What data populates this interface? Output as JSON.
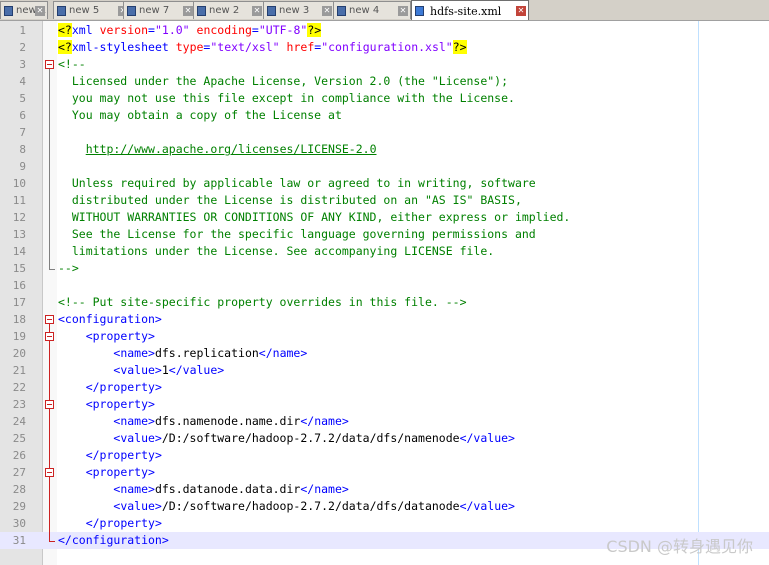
{
  "tabs": [
    {
      "label": "new 1",
      "active": false
    },
    {
      "label": "new 5",
      "active": false
    },
    {
      "label": "new 7",
      "active": false
    },
    {
      "label": "new 2",
      "active": false
    },
    {
      "label": "new 3",
      "active": false
    },
    {
      "label": "new 4",
      "active": false
    },
    {
      "label": "hdfs-site.xml",
      "active": true
    }
  ],
  "tab_icon": "document-icon",
  "close_icon": "close-icon",
  "current_line": 31,
  "lines": [
    {
      "n": "1",
      "tokens": [
        [
          "p",
          "<?"
        ],
        [
          "kw",
          "xml "
        ],
        [
          "at",
          "version"
        ],
        [
          "kw",
          "="
        ],
        [
          "str",
          "\"1.0\""
        ],
        [
          "kw",
          " "
        ],
        [
          "at",
          "encoding"
        ],
        [
          "kw",
          "="
        ],
        [
          "str",
          "\"UTF-8\""
        ],
        [
          "p",
          "?>"
        ]
      ]
    },
    {
      "n": "2",
      "tokens": [
        [
          "p",
          "<?"
        ],
        [
          "kw",
          "xml-stylesheet "
        ],
        [
          "at",
          "type"
        ],
        [
          "kw",
          "="
        ],
        [
          "str",
          "\"text/xsl\""
        ],
        [
          "kw",
          " "
        ],
        [
          "at",
          "href"
        ],
        [
          "kw",
          "="
        ],
        [
          "str",
          "\"configuration.xsl\""
        ],
        [
          "p",
          "?>"
        ]
      ]
    },
    {
      "n": "3",
      "tokens": [
        [
          "cm",
          "<!--"
        ]
      ]
    },
    {
      "n": "4",
      "tokens": [
        [
          "cm",
          "  Licensed under the Apache License, Version 2.0 (the \"License\");"
        ]
      ]
    },
    {
      "n": "5",
      "tokens": [
        [
          "cm",
          "  you may not use this file except in compliance with the License."
        ]
      ]
    },
    {
      "n": "6",
      "tokens": [
        [
          "cm",
          "  You may obtain a copy of the License at"
        ]
      ]
    },
    {
      "n": "7",
      "tokens": []
    },
    {
      "n": "8",
      "tokens": [
        [
          "cm",
          "    "
        ],
        [
          "url",
          "http://www.apache.org/licenses/LICENSE-2.0"
        ]
      ]
    },
    {
      "n": "9",
      "tokens": []
    },
    {
      "n": "10",
      "tokens": [
        [
          "cm",
          "  Unless required by applicable law or agreed to in writing, software"
        ]
      ]
    },
    {
      "n": "11",
      "tokens": [
        [
          "cm",
          "  distributed under the License is distributed on an \"AS IS\" BASIS,"
        ]
      ]
    },
    {
      "n": "12",
      "tokens": [
        [
          "cm",
          "  WITHOUT WARRANTIES OR CONDITIONS OF ANY KIND, either express or implied."
        ]
      ]
    },
    {
      "n": "13",
      "tokens": [
        [
          "cm",
          "  See the License for the specific language governing permissions and"
        ]
      ]
    },
    {
      "n": "14",
      "tokens": [
        [
          "cm",
          "  limitations under the License. See accompanying LICENSE file."
        ]
      ]
    },
    {
      "n": "15",
      "tokens": [
        [
          "cm",
          "-->"
        ]
      ]
    },
    {
      "n": "16",
      "tokens": []
    },
    {
      "n": "17",
      "tokens": [
        [
          "cm",
          "<!-- Put site-specific property overrides in this file. -->"
        ]
      ]
    },
    {
      "n": "18",
      "tokens": [
        [
          "kw",
          "<configuration>"
        ]
      ]
    },
    {
      "n": "19",
      "tokens": [
        [
          "tx",
          "    "
        ],
        [
          "kw",
          "<property>"
        ]
      ]
    },
    {
      "n": "20",
      "tokens": [
        [
          "tx",
          "        "
        ],
        [
          "kw",
          "<name>"
        ],
        [
          "tx",
          "dfs.replication"
        ],
        [
          "kw",
          "</name>"
        ]
      ]
    },
    {
      "n": "21",
      "tokens": [
        [
          "tx",
          "        "
        ],
        [
          "kw",
          "<value>"
        ],
        [
          "tx",
          "1"
        ],
        [
          "kw",
          "</value>"
        ]
      ]
    },
    {
      "n": "22",
      "tokens": [
        [
          "tx",
          "    "
        ],
        [
          "kw",
          "</property>"
        ]
      ]
    },
    {
      "n": "23",
      "tokens": [
        [
          "tx",
          "    "
        ],
        [
          "kw",
          "<property>"
        ]
      ]
    },
    {
      "n": "24",
      "tokens": [
        [
          "tx",
          "        "
        ],
        [
          "kw",
          "<name>"
        ],
        [
          "tx",
          "dfs.namenode.name.dir"
        ],
        [
          "kw",
          "</name>"
        ]
      ]
    },
    {
      "n": "25",
      "tokens": [
        [
          "tx",
          "        "
        ],
        [
          "kw",
          "<value>"
        ],
        [
          "tx",
          "/D:/software/hadoop-2.7.2/data/dfs/namenode"
        ],
        [
          "kw",
          "</value>"
        ]
      ]
    },
    {
      "n": "26",
      "tokens": [
        [
          "tx",
          "    "
        ],
        [
          "kw",
          "</property>"
        ]
      ]
    },
    {
      "n": "27",
      "tokens": [
        [
          "tx",
          "    "
        ],
        [
          "kw",
          "<property>"
        ]
      ]
    },
    {
      "n": "28",
      "tokens": [
        [
          "tx",
          "        "
        ],
        [
          "kw",
          "<name>"
        ],
        [
          "tx",
          "dfs.datanode.data.dir"
        ],
        [
          "kw",
          "</name>"
        ]
      ]
    },
    {
      "n": "29",
      "tokens": [
        [
          "tx",
          "        "
        ],
        [
          "kw",
          "<value>"
        ],
        [
          "tx",
          "/D:/software/hadoop-2.7.2/data/dfs/datanode"
        ],
        [
          "kw",
          "</value>"
        ]
      ]
    },
    {
      "n": "30",
      "tokens": [
        [
          "tx",
          "    "
        ],
        [
          "kw",
          "</property>"
        ]
      ]
    },
    {
      "n": "31",
      "tokens": [
        [
          "kw",
          "</configuration>"
        ]
      ]
    }
  ],
  "watermark": "CSDN @转身遇见你"
}
